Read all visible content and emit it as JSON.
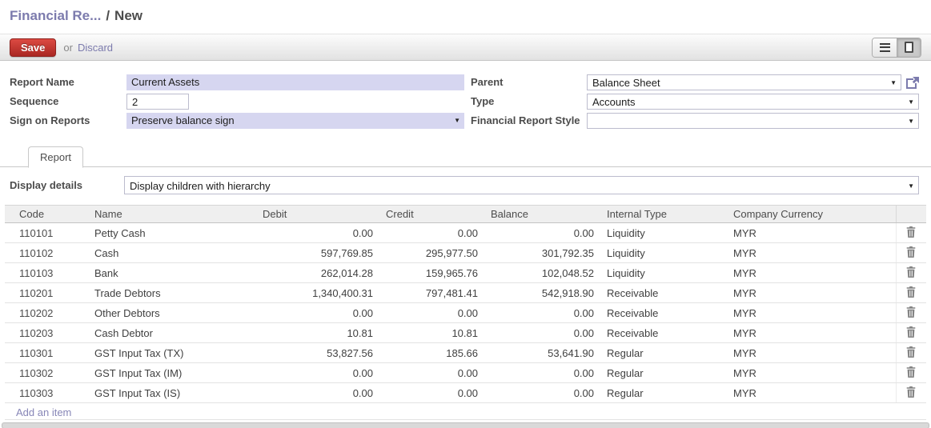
{
  "breadcrumb": {
    "parent": "Financial Re...",
    "separator": "/",
    "current": "New"
  },
  "toolbar": {
    "save_label": "Save",
    "or_label": "or",
    "discard_label": "Discard"
  },
  "view_switcher": {
    "list_button": "list view",
    "form_button": "form view (active)"
  },
  "form": {
    "left": [
      {
        "label": "Report Name",
        "value": "Current Assets"
      },
      {
        "label": "Sequence",
        "value": "2"
      },
      {
        "label": "Sign on Reports",
        "value": "Preserve balance sign"
      }
    ],
    "right": [
      {
        "label": "Parent",
        "value": "Balance Sheet"
      },
      {
        "label": "Type",
        "value": "Accounts"
      },
      {
        "label": "Financial Report Style",
        "value": ""
      }
    ]
  },
  "tabs": [
    {
      "label": "Report",
      "active": true
    }
  ],
  "display_details": {
    "label": "Display details",
    "value": "Display children with hierarchy"
  },
  "table": {
    "columns": [
      "Code",
      "Name",
      "Debit",
      "Credit",
      "Balance",
      "Internal Type",
      "Company Currency"
    ],
    "rows": [
      {
        "code": "110101",
        "name": "Petty Cash",
        "debit": "0.00",
        "credit": "0.00",
        "balance": "0.00",
        "internal_type": "Liquidity",
        "currency": "MYR"
      },
      {
        "code": "110102",
        "name": "Cash",
        "debit": "597,769.85",
        "credit": "295,977.50",
        "balance": "301,792.35",
        "internal_type": "Liquidity",
        "currency": "MYR"
      },
      {
        "code": "110103",
        "name": "Bank",
        "debit": "262,014.28",
        "credit": "159,965.76",
        "balance": "102,048.52",
        "internal_type": "Liquidity",
        "currency": "MYR"
      },
      {
        "code": "110201",
        "name": "Trade Debtors",
        "debit": "1,340,400.31",
        "credit": "797,481.41",
        "balance": "542,918.90",
        "internal_type": "Receivable",
        "currency": "MYR"
      },
      {
        "code": "110202",
        "name": "Other Debtors",
        "debit": "0.00",
        "credit": "0.00",
        "balance": "0.00",
        "internal_type": "Receivable",
        "currency": "MYR"
      },
      {
        "code": "110203",
        "name": "Cash Debtor",
        "debit": "10.81",
        "credit": "10.81",
        "balance": "0.00",
        "internal_type": "Receivable",
        "currency": "MYR"
      },
      {
        "code": "110301",
        "name": "GST Input Tax (TX)",
        "debit": "53,827.56",
        "credit": "185.66",
        "balance": "53,641.90",
        "internal_type": "Regular",
        "currency": "MYR"
      },
      {
        "code": "110302",
        "name": "GST Input Tax (IM)",
        "debit": "0.00",
        "credit": "0.00",
        "balance": "0.00",
        "internal_type": "Regular",
        "currency": "MYR"
      },
      {
        "code": "110303",
        "name": "GST Input Tax (IS)",
        "debit": "0.00",
        "credit": "0.00",
        "balance": "0.00",
        "internal_type": "Regular",
        "currency": "MYR"
      }
    ],
    "add_item_label": "Add an item"
  },
  "colors": {
    "accent": "#7c7bad",
    "save_button": "#aa2823",
    "required_field_bg": "#d6d6f0"
  }
}
